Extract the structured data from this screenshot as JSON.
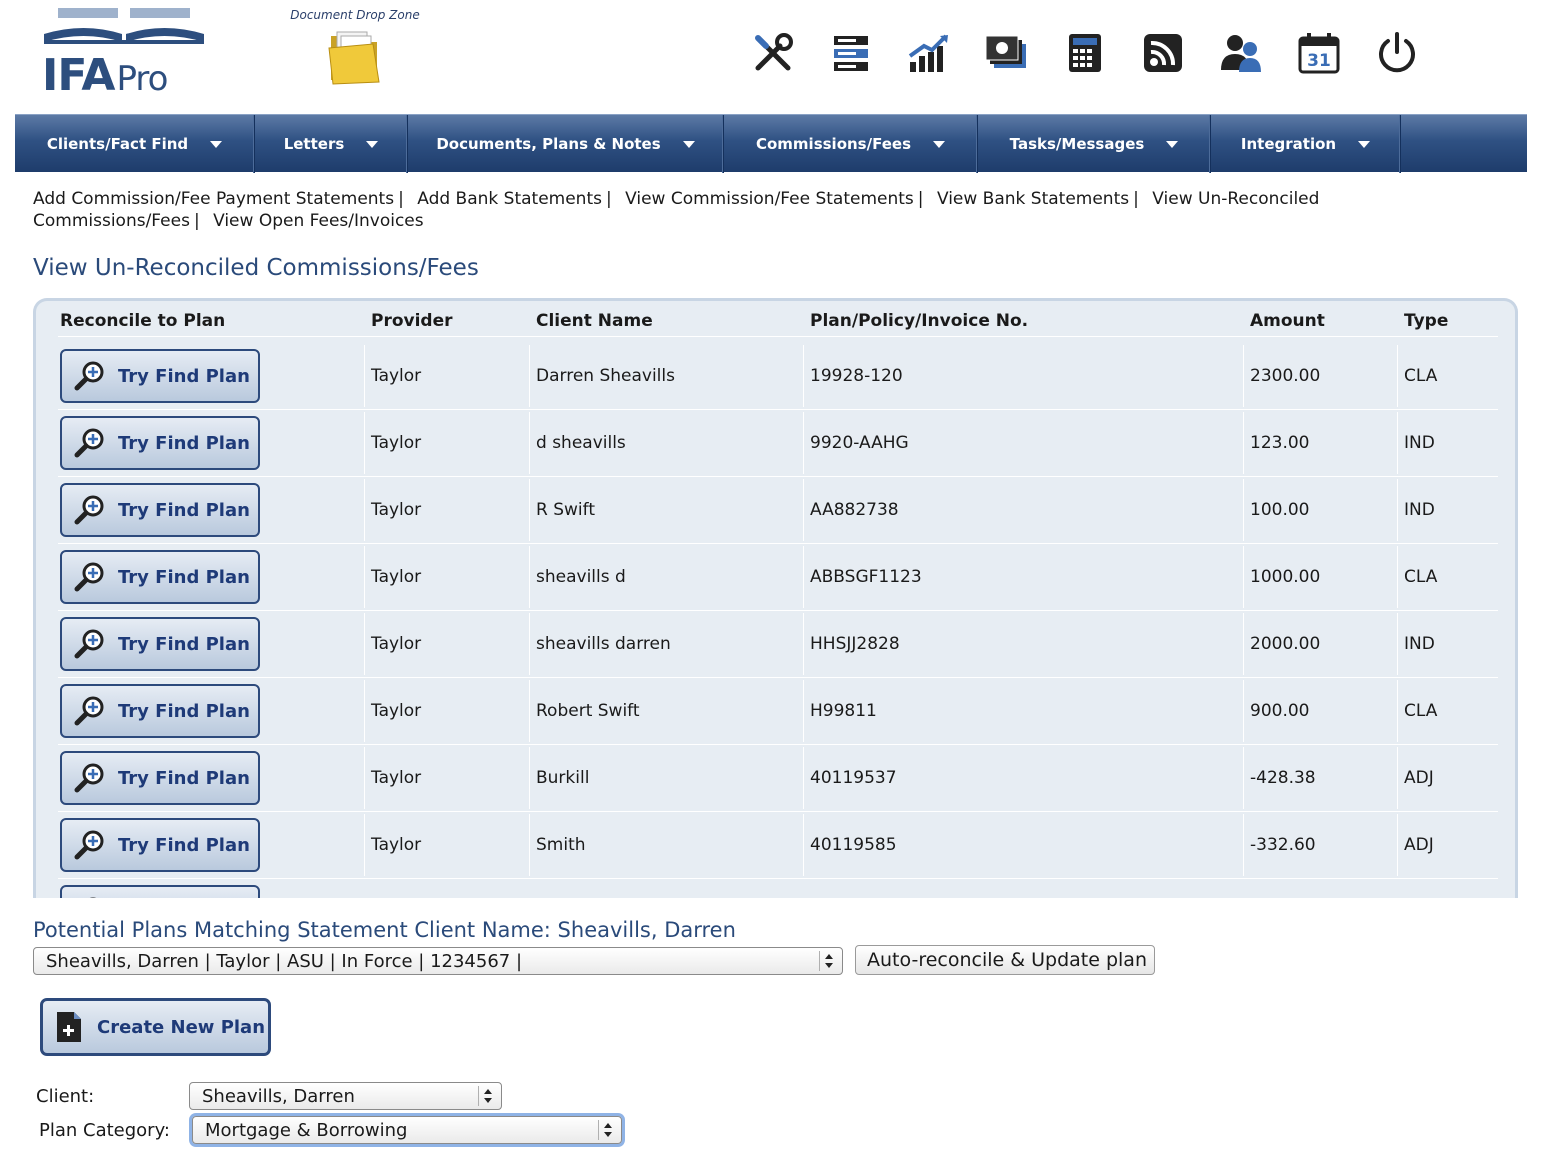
{
  "header": {
    "logo_text": "IFA",
    "logo_suffix": "Pro",
    "dropzone_label": "Document Drop Zone",
    "tools": [
      "tools-icon",
      "server-icon",
      "chart-icon",
      "money-icon",
      "calculator-icon",
      "rss-icon",
      "users-icon",
      "calendar-icon",
      "power-icon"
    ],
    "calendar_day": "31"
  },
  "nav": {
    "items": [
      {
        "label": "Clients/Fact Find"
      },
      {
        "label": "Letters"
      },
      {
        "label": "Documents, Plans & Notes"
      },
      {
        "label": "Commissions/Fees"
      },
      {
        "label": "Tasks/Messages"
      },
      {
        "label": "Integration"
      }
    ]
  },
  "sublinks": [
    "Add Commission/Fee Payment Statements",
    "Add Bank Statements",
    "View Commission/Fee Statements",
    "View Bank Statements",
    "View Un-Reconciled Commissions/Fees",
    "View Open Fees/Invoices"
  ],
  "page_title": "View Un-Reconciled Commissions/Fees",
  "table": {
    "headers": [
      "Reconcile to Plan",
      "Provider",
      "Client Name",
      "Plan/Policy/Invoice No.",
      "Amount",
      "Type"
    ],
    "button_label": "Try Find Plan",
    "rows": [
      {
        "provider": "Taylor",
        "client": "Darren Sheavills",
        "plan": "19928-120",
        "amount": "2300.00",
        "type": "CLA"
      },
      {
        "provider": "Taylor",
        "client": "d sheavills",
        "plan": "9920-AAHG",
        "amount": "123.00",
        "type": "IND"
      },
      {
        "provider": "Taylor",
        "client": "R Swift",
        "plan": "AA882738",
        "amount": "100.00",
        "type": "IND"
      },
      {
        "provider": "Taylor",
        "client": "sheavills d",
        "plan": "ABBSGF1123",
        "amount": "1000.00",
        "type": "CLA"
      },
      {
        "provider": "Taylor",
        "client": "sheavills darren",
        "plan": "HHSJJ2828",
        "amount": "2000.00",
        "type": "IND"
      },
      {
        "provider": "Taylor",
        "client": "Robert Swift",
        "plan": "H99811",
        "amount": "900.00",
        "type": "CLA"
      },
      {
        "provider": "Taylor",
        "client": "Burkill",
        "plan": "40119537",
        "amount": "-428.38",
        "type": "ADJ"
      },
      {
        "provider": "Taylor",
        "client": "Smith",
        "plan": "40119585",
        "amount": "-332.60",
        "type": "ADJ"
      }
    ]
  },
  "matching": {
    "title": "Potential Plans Matching Statement Client Name: Sheavills, Darren",
    "selected_plan": "Sheavills, Darren | Taylor | ASU | In Force | 1234567 |",
    "auto_button": "Auto-reconcile & Update plan"
  },
  "create": {
    "button_label": "Create New Plan",
    "client_label": "Client:",
    "client_value": "Sheavills, Darren",
    "category_label": "Plan Category:",
    "category_value": "Mortgage & Borrowing"
  }
}
